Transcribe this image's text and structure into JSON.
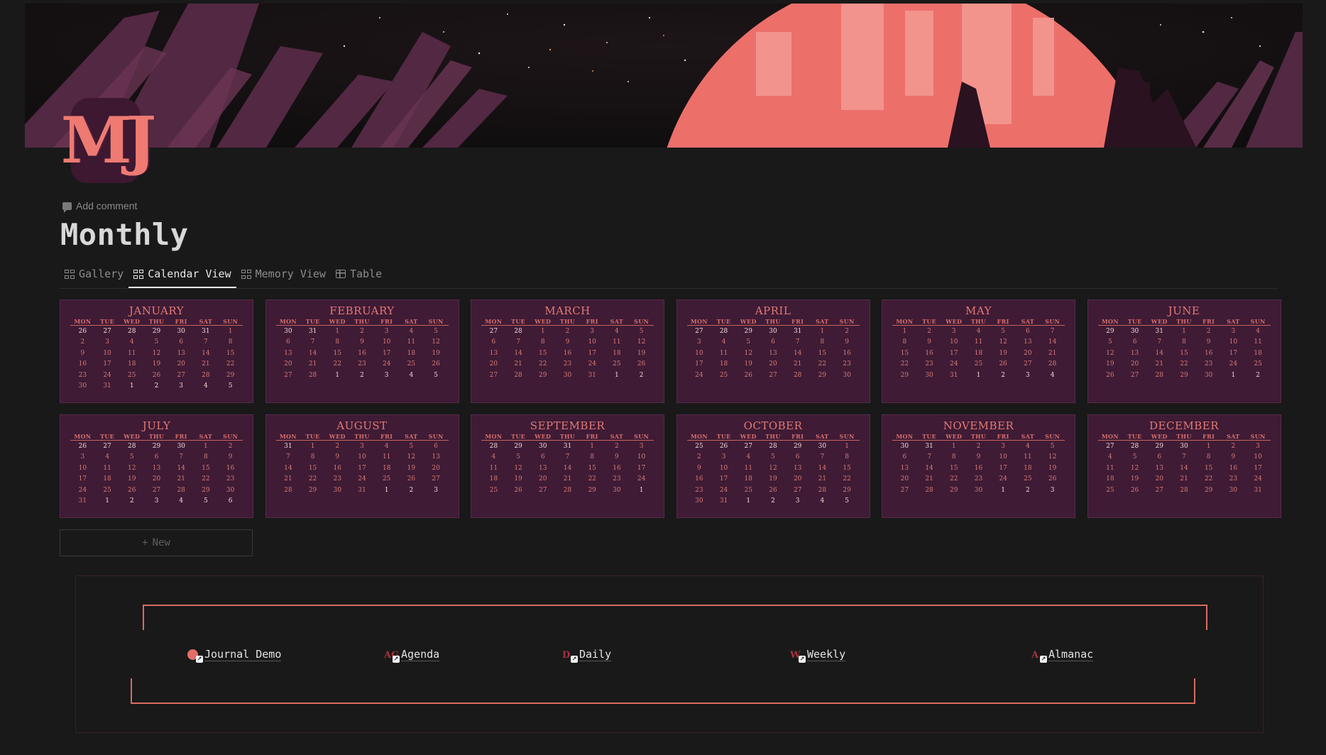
{
  "page": {
    "icon_text": "MJ",
    "add_comment": "Add comment",
    "title": "Monthly"
  },
  "colors": {
    "background": "#191919",
    "card": "#3f1b35",
    "accent": "#e27a74",
    "cover_sun": "#ec6f6a"
  },
  "tabs": [
    {
      "label": "Gallery",
      "icon": "gallery-grid-icon"
    },
    {
      "label": "Calendar View",
      "icon": "gallery-grid-icon",
      "active": true
    },
    {
      "label": "Memory View",
      "icon": "gallery-grid-icon"
    },
    {
      "label": "Table",
      "icon": "table-icon"
    }
  ],
  "weekdays": [
    "MON",
    "TUE",
    "WED",
    "THU",
    "FRI",
    "SAT",
    "SUN"
  ],
  "months": [
    {
      "name": "JANUARY",
      "weeks": [
        [
          26,
          27,
          28,
          29,
          30,
          31,
          1
        ],
        [
          2,
          3,
          4,
          5,
          6,
          7,
          8
        ],
        [
          9,
          10,
          11,
          12,
          13,
          14,
          15
        ],
        [
          16,
          17,
          18,
          19,
          20,
          21,
          22
        ],
        [
          23,
          24,
          25,
          26,
          27,
          28,
          29
        ],
        [
          30,
          31,
          1,
          2,
          3,
          4,
          5
        ]
      ]
    },
    {
      "name": "FEBRUARY",
      "weeks": [
        [
          30,
          31,
          1,
          2,
          3,
          4,
          5
        ],
        [
          6,
          7,
          8,
          9,
          10,
          11,
          12
        ],
        [
          13,
          14,
          15,
          16,
          17,
          18,
          19
        ],
        [
          20,
          21,
          22,
          23,
          24,
          25,
          26
        ],
        [
          27,
          28,
          1,
          2,
          3,
          4,
          5
        ]
      ]
    },
    {
      "name": "MARCH",
      "weeks": [
        [
          27,
          28,
          1,
          2,
          3,
          4,
          5
        ],
        [
          6,
          7,
          8,
          9,
          10,
          11,
          12
        ],
        [
          13,
          14,
          15,
          16,
          17,
          18,
          19
        ],
        [
          20,
          21,
          22,
          23,
          24,
          25,
          26
        ],
        [
          27,
          28,
          29,
          30,
          31,
          1,
          2
        ]
      ]
    },
    {
      "name": "APRIL",
      "weeks": [
        [
          27,
          28,
          29,
          30,
          31,
          1,
          2
        ],
        [
          3,
          4,
          5,
          6,
          7,
          8,
          9
        ],
        [
          10,
          11,
          12,
          13,
          14,
          15,
          16
        ],
        [
          17,
          18,
          19,
          20,
          21,
          22,
          23
        ],
        [
          24,
          25,
          26,
          27,
          28,
          29,
          30
        ]
      ]
    },
    {
      "name": "MAY",
      "weeks": [
        [
          1,
          2,
          3,
          4,
          5,
          6,
          7
        ],
        [
          8,
          9,
          10,
          11,
          12,
          13,
          14
        ],
        [
          15,
          16,
          17,
          18,
          19,
          20,
          21
        ],
        [
          22,
          23,
          24,
          25,
          26,
          27,
          28
        ],
        [
          29,
          30,
          31,
          1,
          2,
          3,
          4
        ]
      ]
    },
    {
      "name": "JUNE",
      "weeks": [
        [
          29,
          30,
          31,
          1,
          2,
          3,
          4
        ],
        [
          5,
          6,
          7,
          8,
          9,
          10,
          11
        ],
        [
          12,
          13,
          14,
          15,
          16,
          17,
          18
        ],
        [
          19,
          20,
          21,
          22,
          23,
          24,
          25
        ],
        [
          26,
          27,
          28,
          29,
          30,
          1,
          2
        ]
      ]
    },
    {
      "name": "JULY",
      "weeks": [
        [
          26,
          27,
          28,
          29,
          30,
          1,
          2
        ],
        [
          3,
          4,
          5,
          6,
          7,
          8,
          9
        ],
        [
          10,
          11,
          12,
          13,
          14,
          15,
          16
        ],
        [
          17,
          18,
          19,
          20,
          21,
          22,
          23
        ],
        [
          24,
          25,
          26,
          27,
          28,
          29,
          30
        ],
        [
          31,
          1,
          2,
          3,
          4,
          5,
          6
        ]
      ]
    },
    {
      "name": "AUGUST",
      "weeks": [
        [
          31,
          1,
          2,
          3,
          4,
          5,
          6
        ],
        [
          7,
          8,
          9,
          10,
          11,
          12,
          13
        ],
        [
          14,
          15,
          16,
          17,
          18,
          19,
          20
        ],
        [
          21,
          22,
          23,
          24,
          25,
          26,
          27
        ],
        [
          28,
          29,
          30,
          31,
          1,
          2,
          3
        ]
      ]
    },
    {
      "name": "SEPTEMBER",
      "weeks": [
        [
          28,
          29,
          30,
          31,
          1,
          2,
          3
        ],
        [
          4,
          5,
          6,
          7,
          8,
          9,
          10
        ],
        [
          11,
          12,
          13,
          14,
          15,
          16,
          17
        ],
        [
          18,
          19,
          20,
          21,
          22,
          23,
          24
        ],
        [
          25,
          26,
          27,
          28,
          29,
          30,
          1
        ]
      ]
    },
    {
      "name": "OCTOBER",
      "weeks": [
        [
          25,
          26,
          27,
          28,
          29,
          30,
          1
        ],
        [
          2,
          3,
          4,
          5,
          6,
          7,
          8
        ],
        [
          9,
          10,
          11,
          12,
          13,
          14,
          15
        ],
        [
          16,
          17,
          18,
          19,
          20,
          21,
          22
        ],
        [
          23,
          24,
          25,
          26,
          27,
          28,
          29
        ],
        [
          30,
          31,
          1,
          2,
          3,
          4,
          5
        ]
      ]
    },
    {
      "name": "NOVEMBER",
      "weeks": [
        [
          30,
          31,
          1,
          2,
          3,
          4,
          5
        ],
        [
          6,
          7,
          8,
          9,
          10,
          11,
          12
        ],
        [
          13,
          14,
          15,
          16,
          17,
          18,
          19
        ],
        [
          20,
          21,
          22,
          23,
          24,
          25,
          26
        ],
        [
          27,
          28,
          29,
          30,
          1,
          2,
          3
        ]
      ]
    },
    {
      "name": "DECEMBER",
      "weeks": [
        [
          27,
          28,
          29,
          30,
          1,
          2,
          3
        ],
        [
          4,
          5,
          6,
          7,
          8,
          9,
          10
        ],
        [
          11,
          12,
          13,
          14,
          15,
          16,
          17
        ],
        [
          18,
          19,
          20,
          21,
          22,
          23,
          24
        ],
        [
          25,
          26,
          27,
          28,
          29,
          30,
          31
        ]
      ]
    }
  ],
  "new_button": {
    "icon": "+",
    "label": "New"
  },
  "links": [
    {
      "label": "Journal Demo",
      "icon_text": "",
      "icon": "red-dot-icon"
    },
    {
      "label": "Agenda",
      "icon_text": "AG",
      "icon": "agenda-logo-icon"
    },
    {
      "label": "Daily",
      "icon_text": "D",
      "icon": "daily-logo-icon"
    },
    {
      "label": "Weekly",
      "icon_text": "W",
      "icon": "weekly-logo-icon"
    },
    {
      "label": "Almanac",
      "icon_text": "A",
      "icon": "almanac-logo-icon"
    }
  ]
}
